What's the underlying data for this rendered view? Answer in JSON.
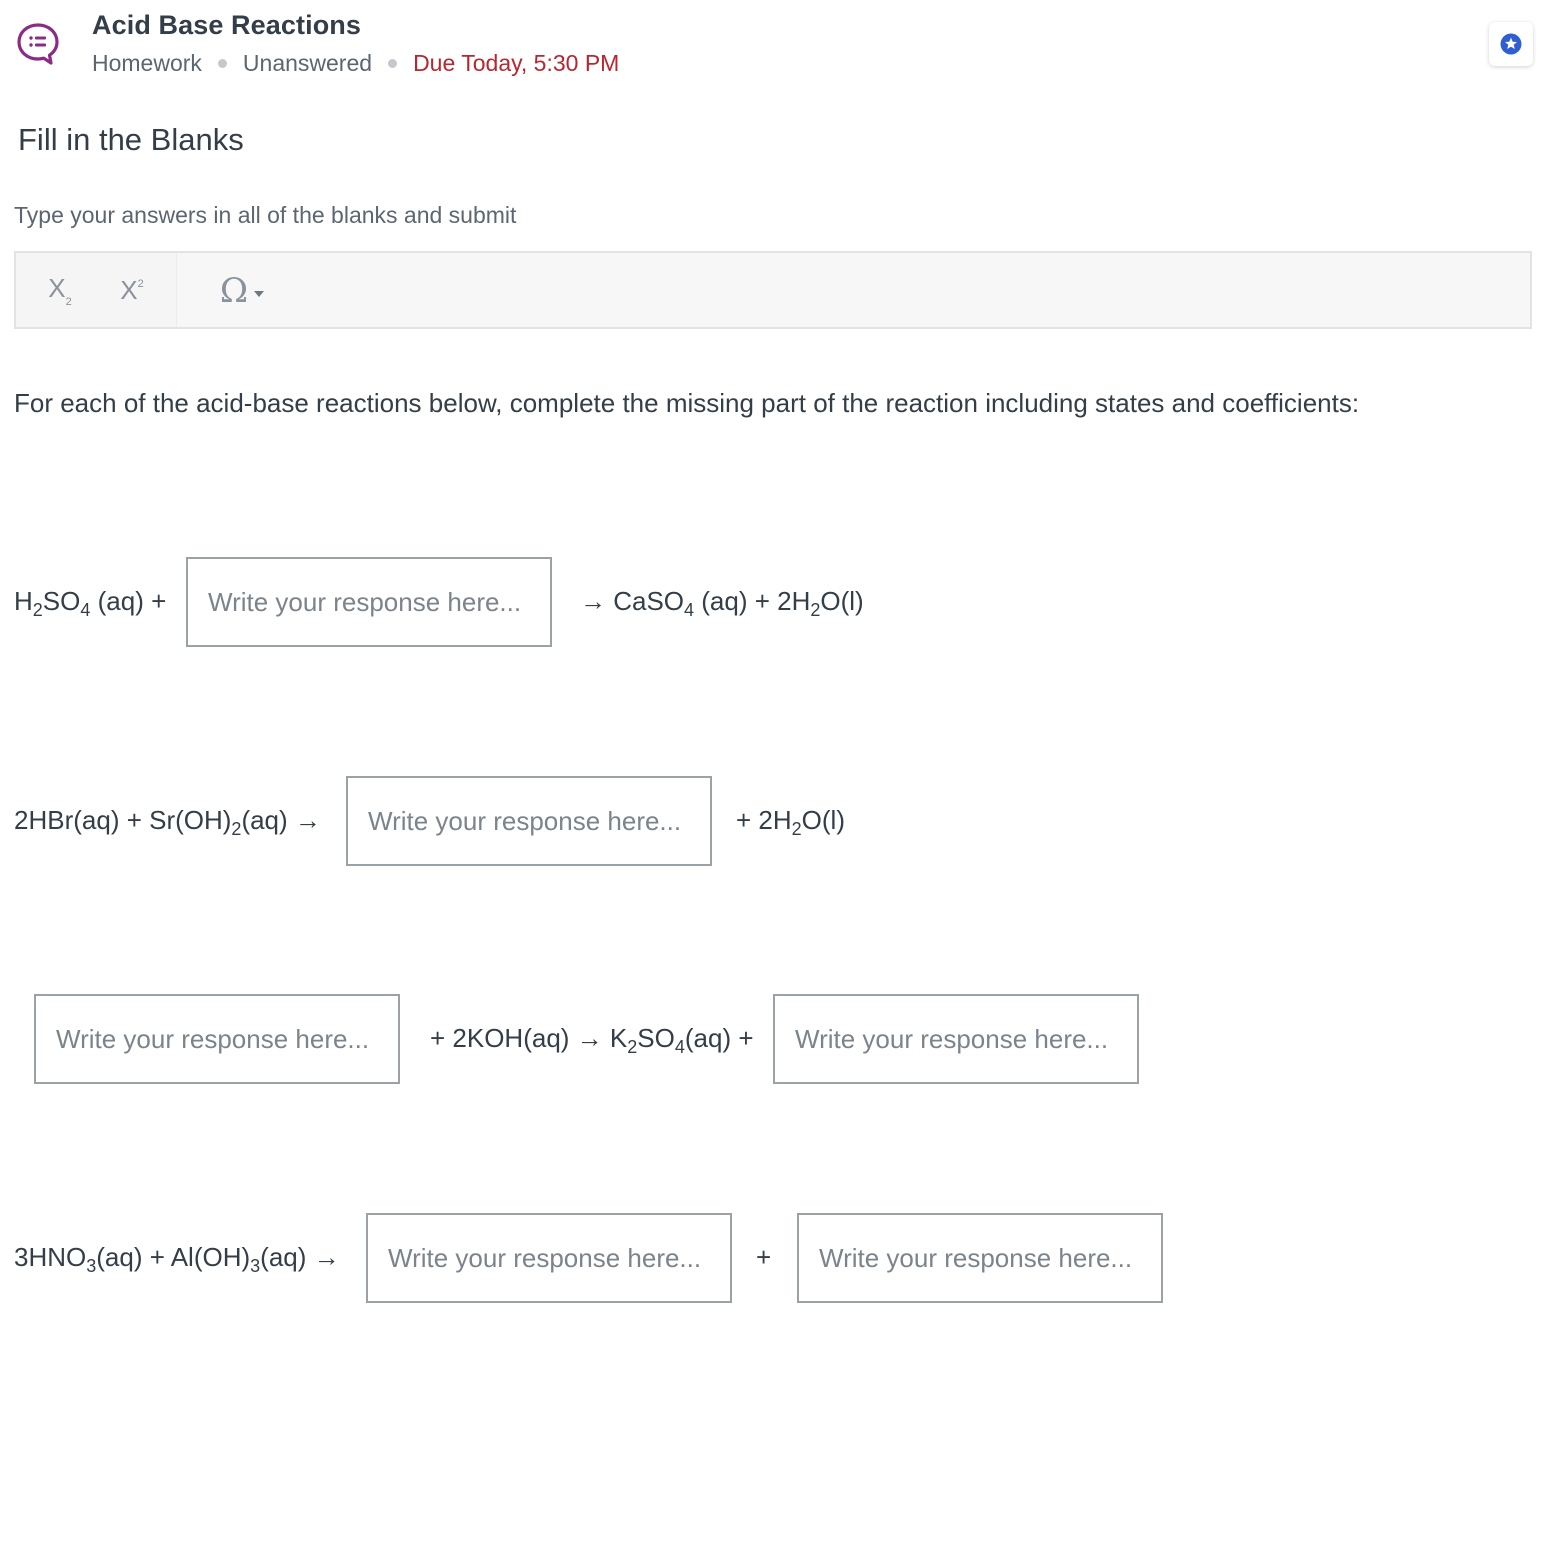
{
  "header": {
    "title": "Acid Base Reactions",
    "type": "Homework",
    "status": "Unanswered",
    "due": "Due Today, 5:30 PM",
    "app_icon": "chat-list-icon",
    "star_icon": "star-icon"
  },
  "question": {
    "section_title": "Fill in the Blanks",
    "instructions": "Type your answers in all of the blanks and submit",
    "prompt": "For each of the acid-base reactions below, complete the missing part of the reaction including states and coefficients:"
  },
  "toolbar": {
    "subscript_label": "X",
    "subscript_mark": "2",
    "superscript_label": "X",
    "superscript_mark": "2",
    "special_chars_label": "Ω"
  },
  "placeholder": "Write your response here...",
  "equations": {
    "eq1": {
      "left_a": "H",
      "left_b": "2",
      "left_c": "SO",
      "left_d": "4",
      "left_e": " (aq) +",
      "right_a": "→ CaSO",
      "right_b": "4",
      "right_c": " (aq) + 2H",
      "right_d": "2",
      "right_e": "O(l)"
    },
    "eq2": {
      "left_a": "2HBr(aq) + Sr(OH)",
      "left_b": "2",
      "left_c": "(aq) →",
      "right": "+ 2H",
      "right_b": "2",
      "right_c": "O(l)"
    },
    "eq3": {
      "middle_a": "+ 2KOH(aq) → ",
      "middle_b": "K",
      "middle_c": "2",
      "middle_d": "SO",
      "middle_e": "4",
      "middle_f": "(aq) +"
    },
    "eq4": {
      "left_a": "3HNO",
      "left_b": "3",
      "left_c": "(aq) + Al(OH)",
      "left_d": "3",
      "left_e": "(aq) →",
      "plus": "+"
    }
  },
  "colors": {
    "accent_purple": "#8a2b86",
    "due_red": "#b8262f",
    "star_blue": "#2f5fd1"
  }
}
